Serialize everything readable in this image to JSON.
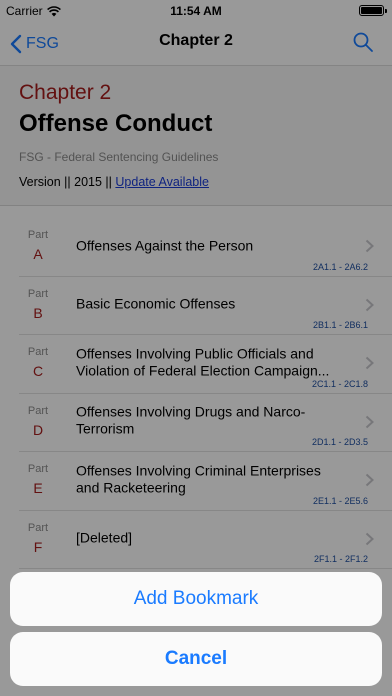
{
  "status": {
    "carrier": "Carrier",
    "time": "11:54 AM"
  },
  "nav": {
    "back_label": "FSG",
    "title": "Chapter 2"
  },
  "header": {
    "chapter": "Chapter 2",
    "title": "Offense Conduct",
    "subtitle": "FSG - Federal Sentencing Guidelines",
    "version_text": "Version || 2015 || ",
    "update_link": "Update Available"
  },
  "parts": [
    {
      "label": "Part",
      "letter": "A",
      "title": "Offenses Against the Person",
      "range": "2A1.1 - 2A6.2"
    },
    {
      "label": "Part",
      "letter": "B",
      "title": "Basic Economic Offenses",
      "range": "2B1.1 - 2B6.1"
    },
    {
      "label": "Part",
      "letter": "C",
      "title": "Offenses Involving Public Officials and Violation of Federal Election Campaign...",
      "range": "2C1.1 - 2C1.8"
    },
    {
      "label": "Part",
      "letter": "D",
      "title": "Offenses Involving Drugs and Narco-Terrorism",
      "range": "2D1.1 - 2D3.5"
    },
    {
      "label": "Part",
      "letter": "E",
      "title": "Offenses Involving Criminal Enterprises and Racketeering",
      "range": "2E1.1 - 2E5.6"
    },
    {
      "label": "Part",
      "letter": "F",
      "title": "[Deleted]",
      "range": "2F1.1 - 2F1.2"
    }
  ],
  "action_sheet": {
    "action_label": "Add Bookmark",
    "cancel_label": "Cancel"
  },
  "colors": {
    "accent": "#1a7bff",
    "chapter_red": "#a51d1d",
    "range_blue": "#1f4fa1"
  }
}
